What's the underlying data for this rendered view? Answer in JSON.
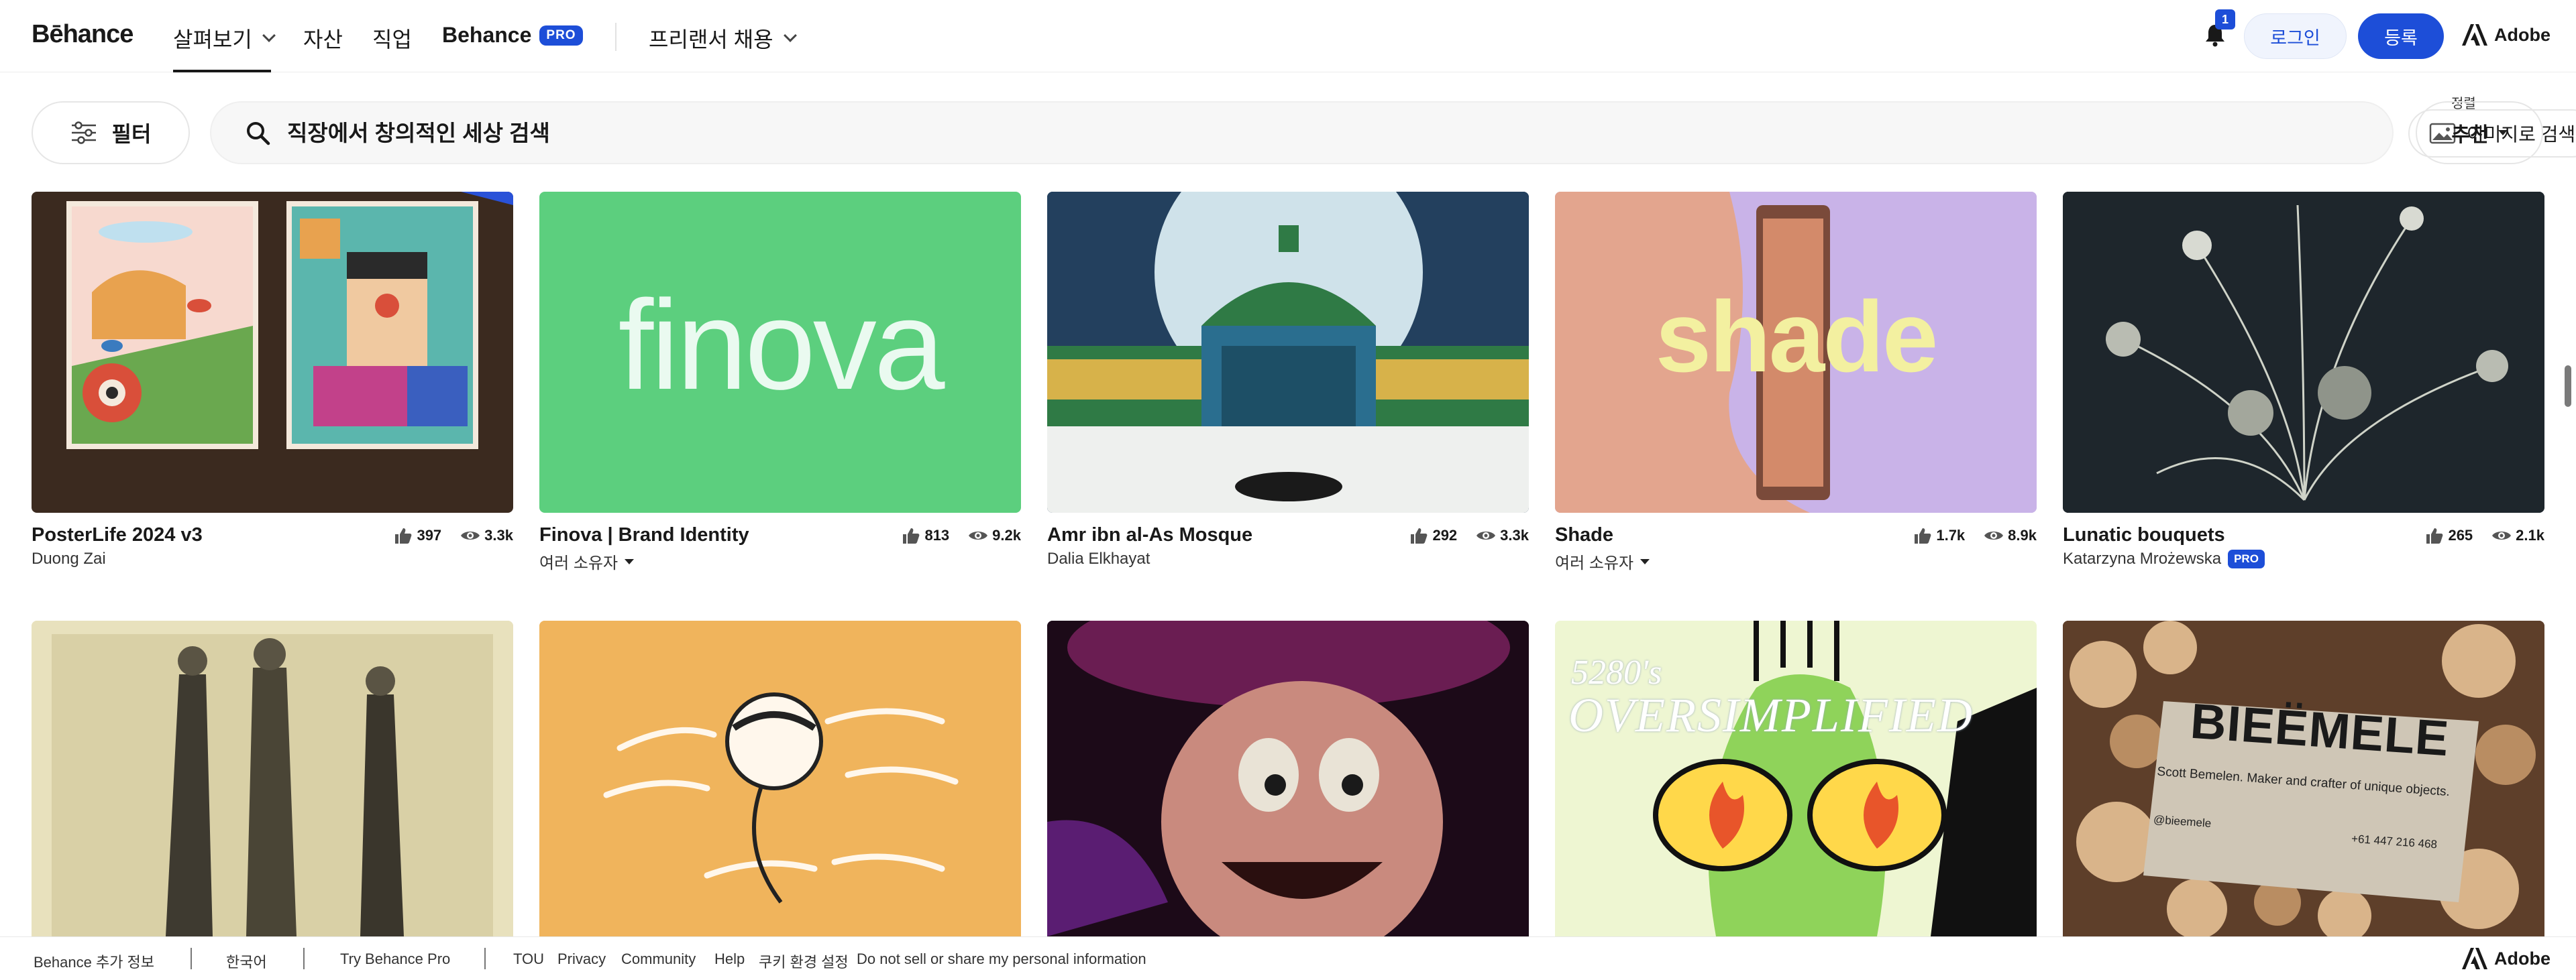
{
  "header": {
    "logo": "Bēhance",
    "nav": {
      "explore": "살펴보기",
      "assets": "자산",
      "jobs": "직업",
      "behance_pro": "Behance",
      "pro_badge": "PRO",
      "hire_freelancers": "프리랜서 채용"
    },
    "notification_count": "1",
    "login": "로그인",
    "signup": "등록",
    "adobe": "Adobe"
  },
  "search": {
    "filter": "필터",
    "placeholder": "직장에서 창의적인 세상 검색",
    "image_search": "이미지로 검색",
    "sort_label": "정렬",
    "sort_value": "추천"
  },
  "projects_row1": [
    {
      "title": "PosterLife 2024 v3",
      "owner": "Duong Zai",
      "likes": "397",
      "views": "3.3k",
      "multi": false,
      "pro": false
    },
    {
      "title": "Finova | Brand Identity",
      "owner": "여러 소유자",
      "likes": "813",
      "views": "9.2k",
      "multi": true,
      "pro": false
    },
    {
      "title": "Amr ibn al-As Mosque",
      "owner": "Dalia Elkhayat",
      "likes": "292",
      "views": "3.3k",
      "multi": false,
      "pro": false
    },
    {
      "title": "Shade",
      "owner": "여러 소유자",
      "likes": "1.7k",
      "views": "8.9k",
      "multi": true,
      "pro": false
    },
    {
      "title": "Lunatic bouquets",
      "owner": "Katarzyna Mrożewska",
      "likes": "265",
      "views": "2.1k",
      "multi": false,
      "pro": true
    }
  ],
  "thumb_text": {
    "finova": "finova",
    "shade": "shade",
    "oversimplified_top": "5280's",
    "oversimplified": "OVERSIMPLIFIED",
    "bieemele": "BIEËMELE",
    "bieemele_sub": "Scott Bemelen. Maker and crafter of unique objects.",
    "bieemele_handle": "@bieemele",
    "bieemele_phone": "+61 447 216 468"
  },
  "pro_small": "PRO",
  "footer": {
    "more": "Behance 추가 정보",
    "language": "한국어",
    "try_pro": "Try Behance Pro",
    "tou": "TOU",
    "privacy": "Privacy",
    "community": "Community",
    "help": "Help",
    "cookies": "쿠키 환경 설정",
    "do_not_sell": "Do not sell or share my personal information",
    "adobe": "Adobe"
  },
  "colors": {
    "accent": "#1d4ed8",
    "finova_green": "#5ccf7e",
    "shade_purple": "#c9b3e8",
    "orange": "#f0b45c"
  }
}
